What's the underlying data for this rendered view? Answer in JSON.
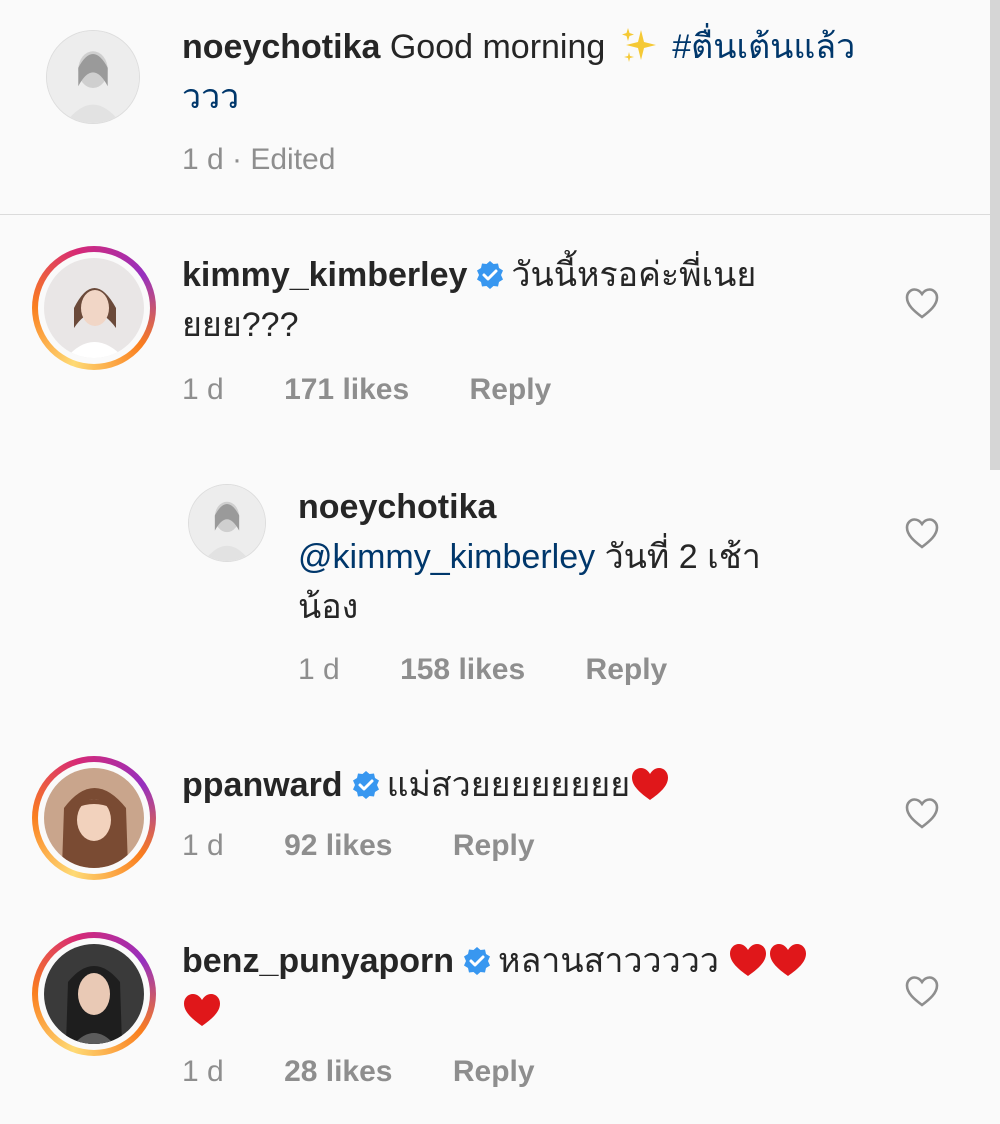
{
  "caption": {
    "username": "noeychotika",
    "text": "Good morning",
    "hashtag_line1": "#ตื่นเต้นแล้ว",
    "hashtag_line2": "ววว",
    "meta": "1 d · Edited"
  },
  "comments": [
    {
      "username": "kimmy_kimberley",
      "verified": true,
      "text_line1": "วันนี้หรอค่ะพี่เนย",
      "text_line2": "ยยย???",
      "time": "1 d",
      "likes": "171 likes",
      "reply": "Reply"
    },
    {
      "username": "noeychotika",
      "mention": "@kimmy_kimberley",
      "text_line1": "วันที่ 2 เช้า",
      "text_line2": "น้อง",
      "time": "1 d",
      "likes": "158 likes",
      "reply": "Reply"
    },
    {
      "username": "ppanward",
      "verified": true,
      "text_line1": "แม่สวยยยยยยยย",
      "time": "1 d",
      "likes": "92 likes",
      "reply": "Reply"
    },
    {
      "username": "benz_punyaporn",
      "verified": true,
      "text_line1": "หลานสาววววว",
      "time": "1 d",
      "likes": "28 likes",
      "reply": "Reply"
    }
  ],
  "colors": {
    "link": "#00376b",
    "meta": "#8e8e8e",
    "verified": "#3897f0",
    "heart": "#e0171a"
  },
  "icons": [
    "verified-badge-icon",
    "heart-outline-icon",
    "red-heart-emoji-icon",
    "sparkles-emoji-icon"
  ]
}
